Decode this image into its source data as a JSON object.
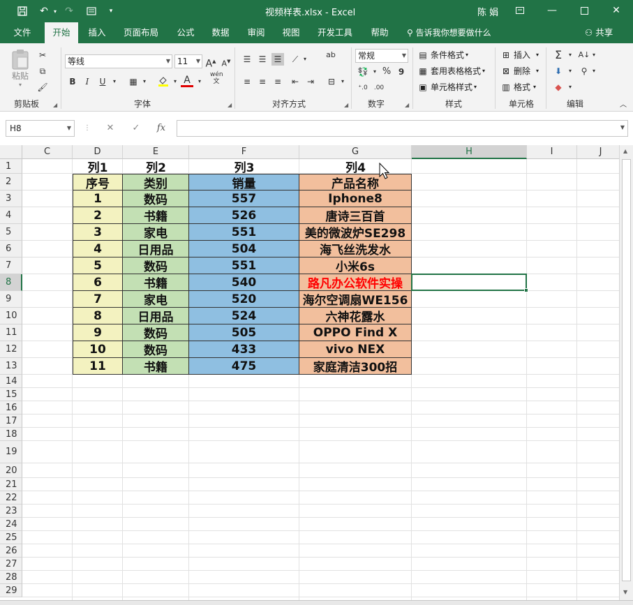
{
  "titlebar": {
    "title": "视频样表.xlsx  -  Excel",
    "user": "陈 娟",
    "accent": "#217346"
  },
  "tabs": [
    {
      "label": "文件"
    },
    {
      "label": "开始"
    },
    {
      "label": "插入"
    },
    {
      "label": "页面布局"
    },
    {
      "label": "公式"
    },
    {
      "label": "数据"
    },
    {
      "label": "审阅"
    },
    {
      "label": "视图"
    },
    {
      "label": "开发工具"
    },
    {
      "label": "帮助"
    }
  ],
  "tellme": "告诉我你想要做什么",
  "share": "共享",
  "ribbon": {
    "clipboard": {
      "paste": "粘贴",
      "label": "剪贴板"
    },
    "font": {
      "name": "等线",
      "size": "11",
      "label": "字体",
      "bold": "B",
      "italic": "I",
      "underline": "U",
      "wen": "wén\n文"
    },
    "align": {
      "label": "对齐方式",
      "wrap": "ab"
    },
    "number": {
      "format": "常规",
      "label": "数字",
      "percent": "%",
      "comma": "9"
    },
    "styles": {
      "cond": "条件格式",
      "table": "套用表格格式",
      "cell": "单元格样式",
      "label": "样式"
    },
    "cells": {
      "insert": "插入",
      "delete": "删除",
      "format": "格式",
      "label": "单元格"
    },
    "editing": {
      "label": "编辑",
      "sum": "Σ"
    }
  },
  "namebox": "H8",
  "fx": "fx",
  "columns": [
    "C",
    "D",
    "E",
    "F",
    "G",
    "H",
    "I",
    "J"
  ],
  "rows": [
    "1",
    "2",
    "3",
    "4",
    "5",
    "6",
    "7",
    "8",
    "9",
    "10",
    "11",
    "12",
    "13",
    "14",
    "15",
    "16",
    "17",
    "18",
    "19",
    "20",
    "21",
    "22",
    "23",
    "24",
    "25",
    "26",
    "27",
    "28",
    "29"
  ],
  "table": {
    "row1": [
      "列1",
      "列2",
      "列3",
      "列4"
    ],
    "header": [
      "序号",
      "类别",
      "销量",
      "产品名称"
    ],
    "rows": [
      [
        "1",
        "数码",
        "557",
        "Iphone8"
      ],
      [
        "2",
        "书籍",
        "526",
        "唐诗三百首"
      ],
      [
        "3",
        "家电",
        "551",
        "美的微波炉SE298"
      ],
      [
        "4",
        "日用品",
        "504",
        "海飞丝洗发水"
      ],
      [
        "5",
        "数码",
        "551",
        "小米6s"
      ],
      [
        "6",
        "书籍",
        "540",
        "路凡办公软件实操"
      ],
      [
        "7",
        "家电",
        "520",
        "海尔空调扇WE156"
      ],
      [
        "8",
        "日用品",
        "524",
        "六神花露水"
      ],
      [
        "9",
        "数码",
        "505",
        "OPPO Find X"
      ],
      [
        "10",
        "数码",
        "433",
        "vivo NEX"
      ],
      [
        "11",
        "书籍",
        "475",
        "家庭清洁300招"
      ]
    ],
    "colors": {
      "D": "#f3f2c0",
      "E": "#c3e0b4",
      "F": "#8fbfe1",
      "G": "#f2bf9d",
      "red_text": "#ff0000"
    }
  }
}
